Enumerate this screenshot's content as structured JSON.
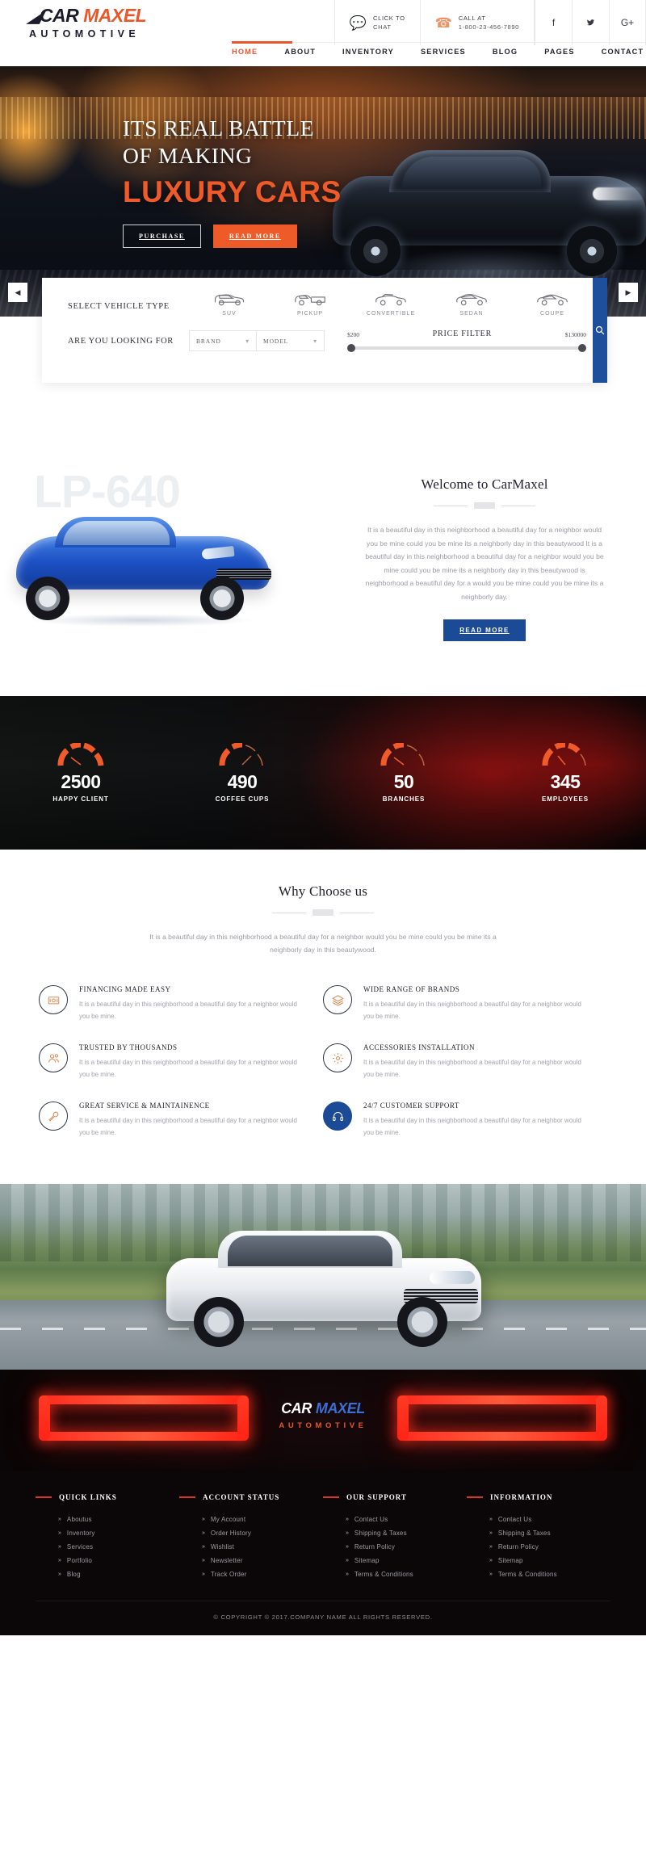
{
  "brand": {
    "mark": "◤",
    "name_part1": "CAR",
    "name_part2": "MAXEL",
    "tagline": "AUTOMOTIVE"
  },
  "header": {
    "chat": {
      "icon": "chat-icon",
      "line1": "CLICK TO",
      "line2": "CHAT"
    },
    "call": {
      "icon": "phone-icon",
      "line1": "CALL AT",
      "line2": "1-800-23-456-7890"
    },
    "social": [
      {
        "name": "facebook-icon",
        "glyph": "f"
      },
      {
        "name": "twitter-icon",
        "glyph": "✉"
      },
      {
        "name": "google-plus-icon",
        "glyph": "G+"
      }
    ],
    "nav": [
      {
        "label": "HOME",
        "active": true
      },
      {
        "label": "ABOUT",
        "active": false
      },
      {
        "label": "INVENTORY",
        "active": false
      },
      {
        "label": "SERVICES",
        "active": false
      },
      {
        "label": "BLOG",
        "active": false
      },
      {
        "label": "PAGES",
        "active": false
      },
      {
        "label": "CONTACT",
        "active": false
      }
    ],
    "search_icon": "search-icon"
  },
  "hero": {
    "line1": "ITS REAL BATTLE",
    "line2": "OF MAKING",
    "line3": "LUXURY CARS",
    "btn_purchase": "PURCHASE",
    "btn_readmore": "READ MORE",
    "arrow_prev": "◀",
    "arrow_next": "▶"
  },
  "filter": {
    "label_type": "SELECT VEHICLE TYPE",
    "label_looking": "ARE YOU LOOKING FOR",
    "vehicle_types": [
      {
        "label": "SUV",
        "icon": "suv-icon"
      },
      {
        "label": "PICKUP",
        "icon": "pickup-icon"
      },
      {
        "label": "CONVERTIBLE",
        "icon": "convertible-icon"
      },
      {
        "label": "SEDAN",
        "icon": "sedan-icon"
      },
      {
        "label": "COUPE",
        "icon": "coupe-icon"
      }
    ],
    "brand_select": "BRAND",
    "model_select": "MODEL",
    "price_title": "PRICE FILTER",
    "price_min": "$200",
    "price_max": "$130000",
    "search_icon": "search-icon",
    "accent_color": "#1e4f9c"
  },
  "welcome": {
    "watermark": "LP-640",
    "title": "Welcome to CarMaxel",
    "paragraph": "It is a beautiful day in this neighborhood a beautiful day for a neighbor would you be mine could you be mine its a neighborly day in this beautywood It is a beautiful day in this neighborhood a beautiful day for a neighbor would you be mine could you be mine its a neighborly day in this beautywood is neighborhood a beautiful day for a would you be mine could you be mine its a neighborly day.",
    "button": "READ MORE"
  },
  "counters": [
    {
      "value": "2500",
      "label": "HAPPY CLIENT"
    },
    {
      "value": "490",
      "label": "COFFEE CUPS"
    },
    {
      "value": "50",
      "label": "BRANCHES"
    },
    {
      "value": "345",
      "label": "EMPLOYEES"
    }
  ],
  "why": {
    "title": "Why Choose us",
    "paragraph": "It is a beautiful day in this neighborhood a beautiful day for a neighbor would you be mine could you be mine its a neighborly day in this beautywood.",
    "features": [
      {
        "icon": "money-icon",
        "title": "FINANCING MADE EASY",
        "text": "It is a beautiful day in this neighborhood a beautiful day for a neighbor would you be mine.",
        "filled": false
      },
      {
        "icon": "layers-icon",
        "title": "WIDE RANGE OF BRANDS",
        "text": "It is a beautiful day in this neighborhood a beautiful day for a neighbor would you be mine.",
        "filled": false
      },
      {
        "icon": "users-icon",
        "title": "TRUSTED BY THOUSANDS",
        "text": "It is a beautiful day in this neighborhood a beautiful day for a neighbor would you be mine.",
        "filled": false
      },
      {
        "icon": "gear-icon",
        "title": "ACCESSORIES INSTALLATION",
        "text": "It is a beautiful day in this neighborhood a beautiful day for a neighbor would you be mine.",
        "filled": false
      },
      {
        "icon": "wrench-icon",
        "title": "GREAT SERVICE & MAINTAINENCE",
        "text": "It is a beautiful day in this neighborhood a beautiful day for a neighbor would you be mine.",
        "filled": false
      },
      {
        "icon": "headset-icon",
        "title": "24/7 CUSTOMER SUPPORT",
        "text": "It is a beautiful day in this neighborhood a beautiful day for a neighbor would you be mine.",
        "filled": true
      }
    ]
  },
  "footer": {
    "columns": [
      {
        "head": "QUICK LINKS",
        "links": [
          "Aboutus",
          "Inventory",
          "Services",
          "Portfolio",
          "Blog"
        ]
      },
      {
        "head": "ACCOUNT STATUS",
        "links": [
          "My Account",
          "Order History",
          "Wishlist",
          "Newsletter",
          "Track Order"
        ]
      },
      {
        "head": "OUR SUPPORT",
        "links": [
          "Contact Us",
          "Shipping & Taxes",
          "Return Policy",
          "Sitemap",
          "Terms & Conditions"
        ]
      },
      {
        "head": "INFORMATION",
        "links": [
          "Contact Us",
          "Shipping & Taxes",
          "Return Policy",
          "Sitemap",
          "Terms & Conditions"
        ]
      }
    ],
    "copyright": "© COPYRIGHT © 2017.COMPANY NAME ALL RIGHTS RESERVED."
  },
  "colors": {
    "orange": "#e8562a",
    "blue": "#1b4a96",
    "dark": "#0b0708",
    "red": "#d4381e"
  }
}
